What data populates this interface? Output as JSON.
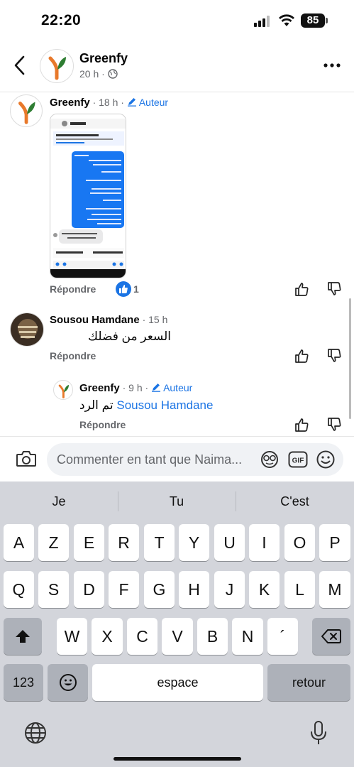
{
  "status": {
    "time": "22:20",
    "battery": "85"
  },
  "header": {
    "title": "Greenfy",
    "meta": "20 h · "
  },
  "comments": [
    {
      "name": "Greenfy",
      "time": " · 18 h · ",
      "badge": "Auteur",
      "reply": "Répondre",
      "likes": "1"
    },
    {
      "name": "Sousou Hamdane",
      "time": " · 15 h",
      "text": "السعر من فضلك",
      "reply": "Répondre"
    },
    {
      "name": "Greenfy",
      "time": " · 9 h · ",
      "badge": "Auteur",
      "mention": "Sousou Hamdane",
      "text": "تم الرد ",
      "reply": "Répondre"
    }
  ],
  "screenshot": {
    "contact": "Abad Saj",
    "banner": "Ceci est une réponse à une publicité",
    "order_label": "Créer la commande",
    "call_label": "Demande d'appel"
  },
  "composer": {
    "placeholder": "Commenter en tant que Naima..."
  },
  "keyboard": {
    "suggestions": [
      "Je",
      "Tu",
      "C'est"
    ],
    "row1": [
      "A",
      "Z",
      "E",
      "R",
      "T",
      "Y",
      "U",
      "I",
      "O",
      "P"
    ],
    "row2": [
      "Q",
      "S",
      "D",
      "F",
      "G",
      "H",
      "J",
      "K",
      "L",
      "M"
    ],
    "row3": [
      "W",
      "X",
      "C",
      "V",
      "B",
      "N",
      "´"
    ],
    "numbers_label": "123",
    "space_label": "espace",
    "return_label": "retour"
  },
  "colors": {
    "accent": "#1b74e4",
    "logo_orange": "#e8792b",
    "logo_green": "#2e7d32"
  }
}
